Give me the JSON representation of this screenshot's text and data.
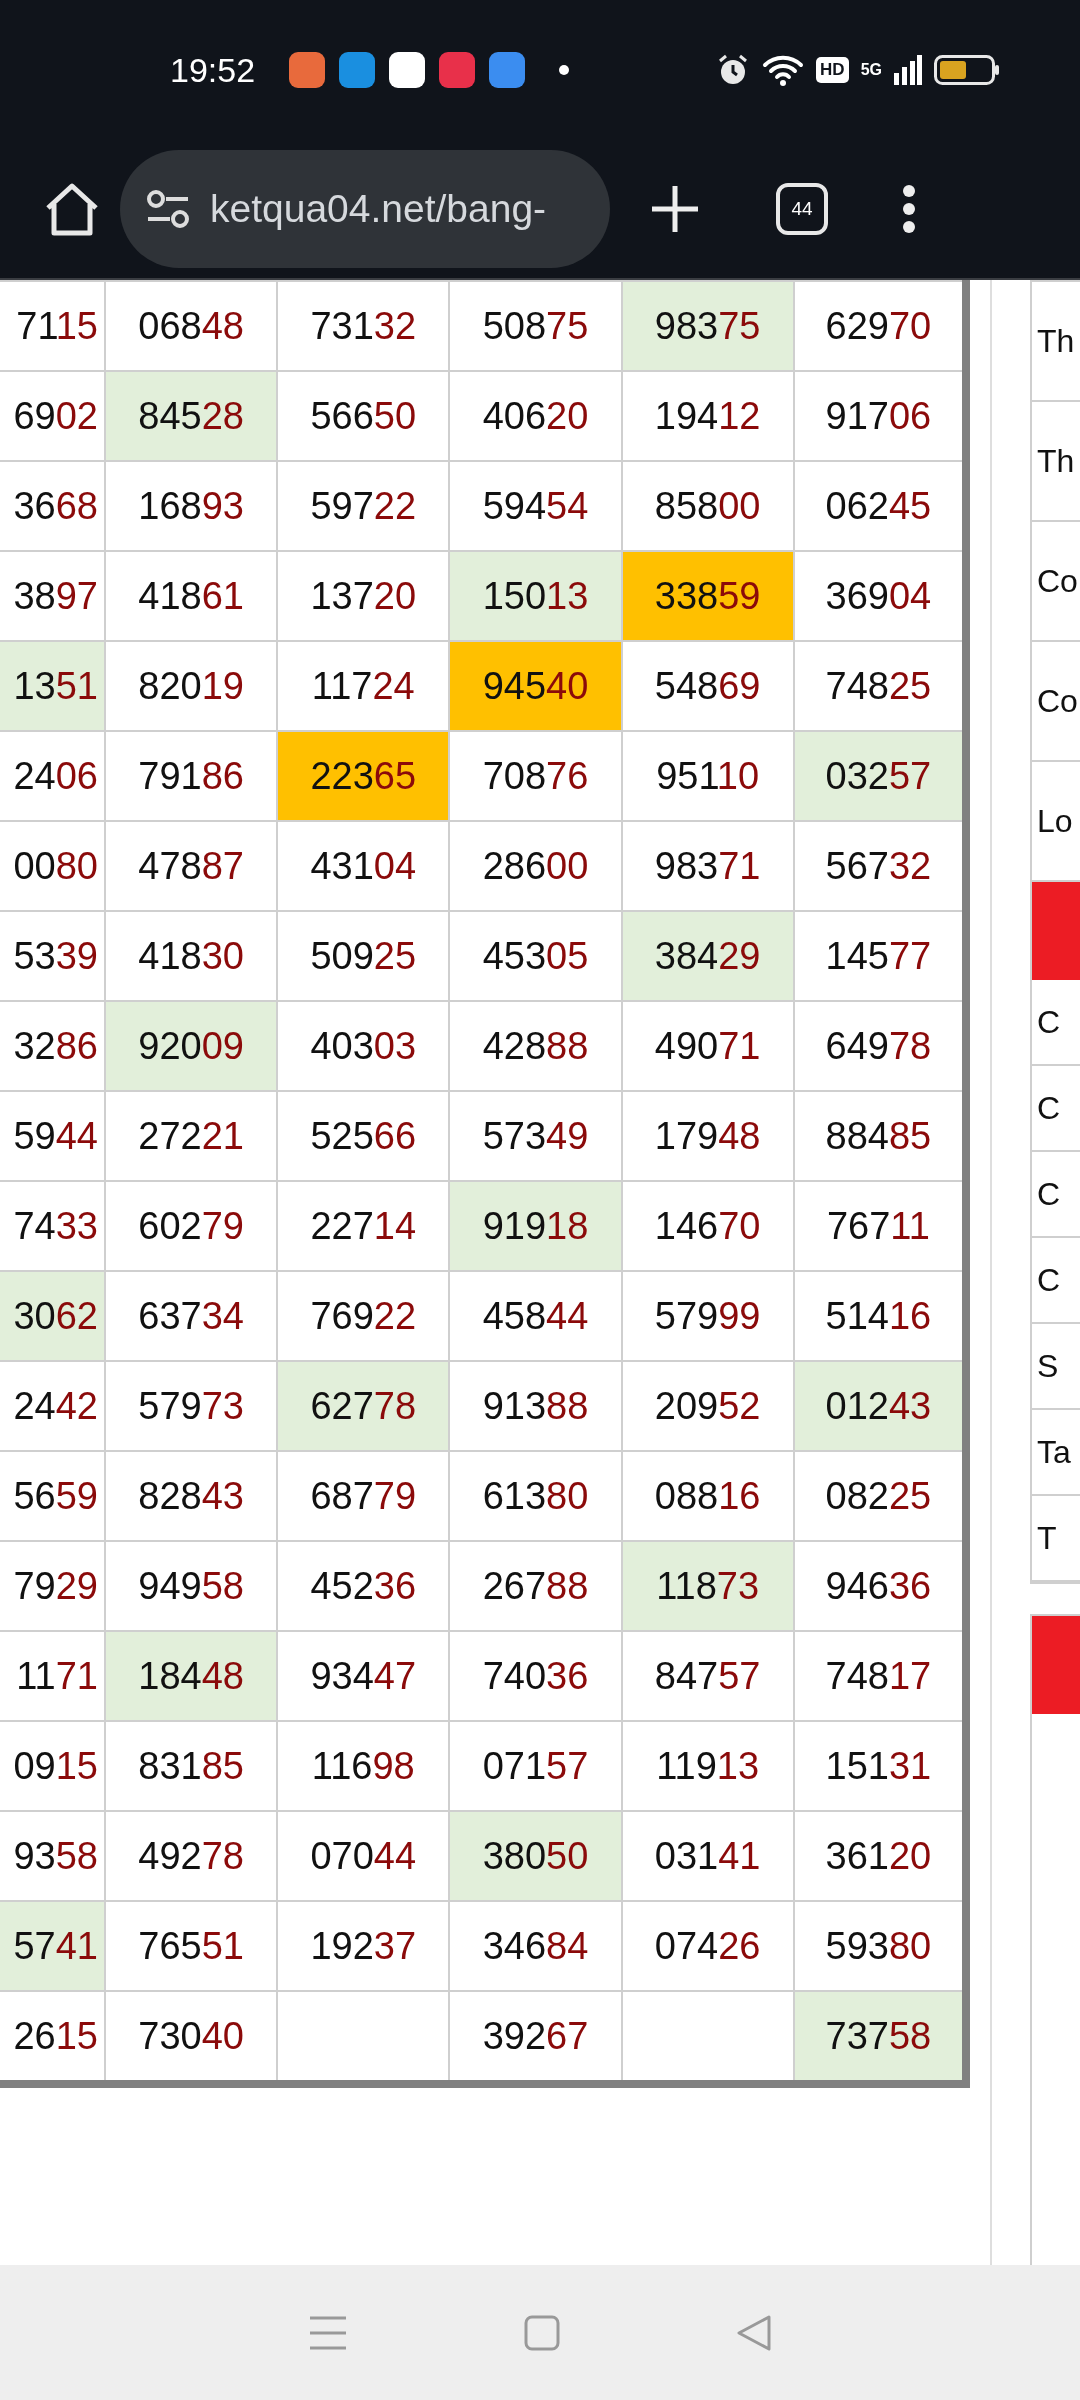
{
  "status_bar": {
    "time": "19:52",
    "network": "5G",
    "hd": "HD"
  },
  "browser": {
    "url": "ketqua04.net/bang-",
    "tab_count": "44"
  },
  "table": {
    "rows": [
      [
        {
          "head": "71",
          "tail": "15",
          "color": "#ffffff"
        },
        {
          "head": "068",
          "tail": "48",
          "color": "#ffffff"
        },
        {
          "head": "731",
          "tail": "32",
          "color": "#ffffff"
        },
        {
          "head": "508",
          "tail": "75",
          "color": "#ffffff"
        },
        {
          "head": "983",
          "tail": "75",
          "color": "#e2efda"
        },
        {
          "head": "629",
          "tail": "70",
          "color": "#ffffff"
        }
      ],
      [
        {
          "head": "69",
          "tail": "02",
          "color": "#ffffff"
        },
        {
          "head": "845",
          "tail": "28",
          "color": "#e2efda"
        },
        {
          "head": "566",
          "tail": "50",
          "color": "#ffffff"
        },
        {
          "head": "406",
          "tail": "20",
          "color": "#ffffff"
        },
        {
          "head": "194",
          "tail": "12",
          "color": "#ffffff"
        },
        {
          "head": "917",
          "tail": "06",
          "color": "#ffffff"
        }
      ],
      [
        {
          "head": "36",
          "tail": "68",
          "color": "#ffffff"
        },
        {
          "head": "168",
          "tail": "93",
          "color": "#ffffff"
        },
        {
          "head": "597",
          "tail": "22",
          "color": "#ffffff"
        },
        {
          "head": "594",
          "tail": "54",
          "color": "#ffffff"
        },
        {
          "head": "858",
          "tail": "00",
          "color": "#ffffff"
        },
        {
          "head": "062",
          "tail": "45",
          "color": "#ffffff"
        }
      ],
      [
        {
          "head": "38",
          "tail": "97",
          "color": "#ffffff"
        },
        {
          "head": "418",
          "tail": "61",
          "color": "#ffffff"
        },
        {
          "head": "137",
          "tail": "20",
          "color": "#ffffff"
        },
        {
          "head": "150",
          "tail": "13",
          "color": "#e2efda"
        },
        {
          "head": "338",
          "tail": "59",
          "color": "#ffc000"
        },
        {
          "head": "369",
          "tail": "04",
          "color": "#ffffff"
        }
      ],
      [
        {
          "head": "13",
          "tail": "51",
          "color": "#e2efda"
        },
        {
          "head": "820",
          "tail": "19",
          "color": "#ffffff"
        },
        {
          "head": "117",
          "tail": "24",
          "color": "#ffffff"
        },
        {
          "head": "945",
          "tail": "40",
          "color": "#ffc000"
        },
        {
          "head": "548",
          "tail": "69",
          "color": "#ffffff"
        },
        {
          "head": "748",
          "tail": "25",
          "color": "#ffffff"
        }
      ],
      [
        {
          "head": "24",
          "tail": "06",
          "color": "#ffffff"
        },
        {
          "head": "791",
          "tail": "86",
          "color": "#ffffff"
        },
        {
          "head": "223",
          "tail": "65",
          "color": "#ffc000"
        },
        {
          "head": "708",
          "tail": "76",
          "color": "#ffffff"
        },
        {
          "head": "951",
          "tail": "10",
          "color": "#ffffff"
        },
        {
          "head": "032",
          "tail": "57",
          "color": "#e2efda"
        }
      ],
      [
        {
          "head": "00",
          "tail": "80",
          "color": "#ffffff"
        },
        {
          "head": "478",
          "tail": "87",
          "color": "#ffffff"
        },
        {
          "head": "431",
          "tail": "04",
          "color": "#ffffff"
        },
        {
          "head": "286",
          "tail": "00",
          "color": "#ffffff"
        },
        {
          "head": "983",
          "tail": "71",
          "color": "#ffffff"
        },
        {
          "head": "567",
          "tail": "32",
          "color": "#ffffff"
        }
      ],
      [
        {
          "head": "53",
          "tail": "39",
          "color": "#ffffff"
        },
        {
          "head": "418",
          "tail": "30",
          "color": "#ffffff"
        },
        {
          "head": "509",
          "tail": "25",
          "color": "#ffffff"
        },
        {
          "head": "453",
          "tail": "05",
          "color": "#ffffff"
        },
        {
          "head": "384",
          "tail": "29",
          "color": "#e2efda"
        },
        {
          "head": "145",
          "tail": "77",
          "color": "#ffffff"
        }
      ],
      [
        {
          "head": "32",
          "tail": "86",
          "color": "#ffffff"
        },
        {
          "head": "920",
          "tail": "09",
          "color": "#e2efda"
        },
        {
          "head": "403",
          "tail": "03",
          "color": "#ffffff"
        },
        {
          "head": "428",
          "tail": "88",
          "color": "#ffffff"
        },
        {
          "head": "490",
          "tail": "71",
          "color": "#ffffff"
        },
        {
          "head": "649",
          "tail": "78",
          "color": "#ffffff"
        }
      ],
      [
        {
          "head": "59",
          "tail": "44",
          "color": "#ffffff"
        },
        {
          "head": "272",
          "tail": "21",
          "color": "#ffffff"
        },
        {
          "head": "525",
          "tail": "66",
          "color": "#ffffff"
        },
        {
          "head": "573",
          "tail": "49",
          "color": "#ffffff"
        },
        {
          "head": "179",
          "tail": "48",
          "color": "#ffffff"
        },
        {
          "head": "884",
          "tail": "85",
          "color": "#ffffff"
        }
      ],
      [
        {
          "head": "74",
          "tail": "33",
          "color": "#ffffff"
        },
        {
          "head": "602",
          "tail": "79",
          "color": "#ffffff"
        },
        {
          "head": "227",
          "tail": "14",
          "color": "#ffffff"
        },
        {
          "head": "919",
          "tail": "18",
          "color": "#e2efda"
        },
        {
          "head": "146",
          "tail": "70",
          "color": "#ffffff"
        },
        {
          "head": "767",
          "tail": "11",
          "color": "#ffffff"
        }
      ],
      [
        {
          "head": "30",
          "tail": "62",
          "color": "#e2efda"
        },
        {
          "head": "637",
          "tail": "34",
          "color": "#ffffff"
        },
        {
          "head": "769",
          "tail": "22",
          "color": "#ffffff"
        },
        {
          "head": "458",
          "tail": "44",
          "color": "#ffffff"
        },
        {
          "head": "579",
          "tail": "99",
          "color": "#ffffff"
        },
        {
          "head": "514",
          "tail": "16",
          "color": "#ffffff"
        }
      ],
      [
        {
          "head": "24",
          "tail": "42",
          "color": "#ffffff"
        },
        {
          "head": "579",
          "tail": "73",
          "color": "#ffffff"
        },
        {
          "head": "627",
          "tail": "78",
          "color": "#e2efda"
        },
        {
          "head": "913",
          "tail": "88",
          "color": "#ffffff"
        },
        {
          "head": "209",
          "tail": "52",
          "color": "#ffffff"
        },
        {
          "head": "012",
          "tail": "43",
          "color": "#e2efda"
        }
      ],
      [
        {
          "head": "56",
          "tail": "59",
          "color": "#ffffff"
        },
        {
          "head": "828",
          "tail": "43",
          "color": "#ffffff"
        },
        {
          "head": "687",
          "tail": "79",
          "color": "#ffffff"
        },
        {
          "head": "613",
          "tail": "80",
          "color": "#ffffff"
        },
        {
          "head": "088",
          "tail": "16",
          "color": "#ffffff"
        },
        {
          "head": "082",
          "tail": "25",
          "color": "#ffffff"
        }
      ],
      [
        {
          "head": "79",
          "tail": "29",
          "color": "#ffffff"
        },
        {
          "head": "949",
          "tail": "58",
          "color": "#ffffff"
        },
        {
          "head": "452",
          "tail": "36",
          "color": "#ffffff"
        },
        {
          "head": "267",
          "tail": "88",
          "color": "#ffffff"
        },
        {
          "head": "118",
          "tail": "73",
          "color": "#e2efda"
        },
        {
          "head": "946",
          "tail": "36",
          "color": "#ffffff"
        }
      ],
      [
        {
          "head": "11",
          "tail": "71",
          "color": "#ffffff"
        },
        {
          "head": "184",
          "tail": "48",
          "color": "#e2efda"
        },
        {
          "head": "934",
          "tail": "47",
          "color": "#ffffff"
        },
        {
          "head": "740",
          "tail": "36",
          "color": "#ffffff"
        },
        {
          "head": "847",
          "tail": "57",
          "color": "#ffffff"
        },
        {
          "head": "748",
          "tail": "17",
          "color": "#ffffff"
        }
      ],
      [
        {
          "head": "09",
          "tail": "15",
          "color": "#ffffff"
        },
        {
          "head": "831",
          "tail": "85",
          "color": "#ffffff"
        },
        {
          "head": "116",
          "tail": "98",
          "color": "#ffffff"
        },
        {
          "head": "071",
          "tail": "57",
          "color": "#ffffff"
        },
        {
          "head": "119",
          "tail": "13",
          "color": "#ffffff"
        },
        {
          "head": "151",
          "tail": "31",
          "color": "#ffffff"
        }
      ],
      [
        {
          "head": "93",
          "tail": "58",
          "color": "#ffffff"
        },
        {
          "head": "492",
          "tail": "78",
          "color": "#ffffff"
        },
        {
          "head": "070",
          "tail": "44",
          "color": "#ffffff"
        },
        {
          "head": "380",
          "tail": "50",
          "color": "#e2efda"
        },
        {
          "head": "031",
          "tail": "41",
          "color": "#ffffff"
        },
        {
          "head": "361",
          "tail": "20",
          "color": "#ffffff"
        }
      ],
      [
        {
          "head": "57",
          "tail": "41",
          "color": "#e2efda"
        },
        {
          "head": "765",
          "tail": "51",
          "color": "#ffffff"
        },
        {
          "head": "192",
          "tail": "37",
          "color": "#ffffff"
        },
        {
          "head": "346",
          "tail": "84",
          "color": "#ffffff"
        },
        {
          "head": "074",
          "tail": "26",
          "color": "#ffffff"
        },
        {
          "head": "593",
          "tail": "80",
          "color": "#ffffff"
        }
      ],
      [
        {
          "head": "26",
          "tail": "15",
          "color": "#ffffff"
        },
        {
          "head": "730",
          "tail": "40",
          "color": "#ffffff"
        },
        {
          "color": "#ffffff"
        },
        {
          "head": "392",
          "tail": "67",
          "color": "#ffffff"
        },
        {
          "color": "#ffffff"
        },
        {
          "head": "737",
          "tail": "58",
          "color": "#e2efda"
        }
      ]
    ]
  },
  "sidebar": {
    "card_1_items": [
      "Th",
      "Th",
      "Co",
      "Co",
      "Lo"
    ],
    "card_2_items": [
      "C",
      "C",
      "C",
      "C",
      "S",
      "Ta",
      "T"
    ]
  }
}
